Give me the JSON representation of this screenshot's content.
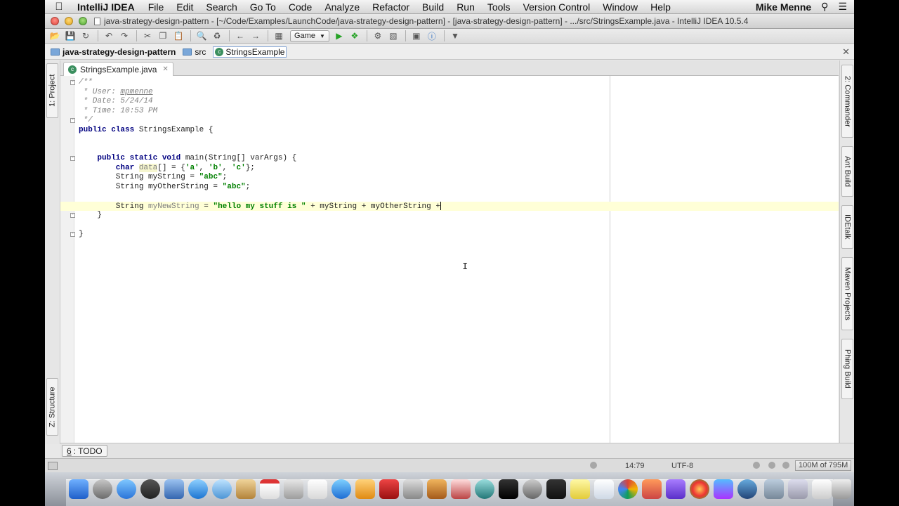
{
  "menubar": {
    "app": "IntelliJ IDEA",
    "menus": [
      "File",
      "Edit",
      "Search",
      "Go To",
      "Code",
      "Analyze",
      "Refactor",
      "Build",
      "Run",
      "Tools",
      "Version Control",
      "Window",
      "Help"
    ],
    "user": "Mike Menne"
  },
  "window": {
    "title": "java-strategy-design-pattern - [~/Code/Examples/LaunchCode/java-strategy-design-pattern] - [java-strategy-design-pattern] - .../src/StringsExample.java - IntelliJ IDEA 10.5.4"
  },
  "toolbar": {
    "run_config": "Game"
  },
  "navbar": {
    "crumbs": [
      "java-strategy-design-pattern",
      "src",
      "StringsExample"
    ]
  },
  "left_tools": {
    "project": "1: Project",
    "structure": "Z: Structure"
  },
  "right_tools": [
    "2: Commander",
    "Ant Build",
    "IDEtalk",
    "Maven Projects",
    "Phing Build"
  ],
  "editor": {
    "tab": "StringsExample.java",
    "lines": {
      "l1": "/**",
      "l2a": " * User: ",
      "l2b": "mpmenne",
      "l3": " * Date: 5/24/14",
      "l4": " * Time: 10:53 PM",
      "l5": " */",
      "l6a": "public class ",
      "l6b": "StringsExample {",
      "l9a": "    public static void ",
      "l9b": "main(String[] varArgs) {",
      "l10a": "        char ",
      "l10b": "data",
      "l10c": "[] = {",
      "l10d": "'a'",
      "l10e": ", ",
      "l10f": "'b'",
      "l10g": ", ",
      "l10h": "'c'",
      "l10i": "};",
      "l11a": "        String myString = ",
      "l11b": "\"abc\"",
      "l11c": ";",
      "l12a": "        String myOtherString = ",
      "l12b": "\"abc\"",
      "l12c": ";",
      "l14a": "        String ",
      "l14b": "myNewString",
      "l14c": " = ",
      "l14d": "\"hello my stuff is \"",
      "l14e": " + myString + myOtherString +",
      "l15": "    }",
      "l17": "}"
    }
  },
  "bottom": {
    "todo_num": "6",
    "todo_label": ": TODO"
  },
  "status": {
    "position": "14:79",
    "encoding": "UTF-8",
    "memory": "100M of 795M"
  }
}
